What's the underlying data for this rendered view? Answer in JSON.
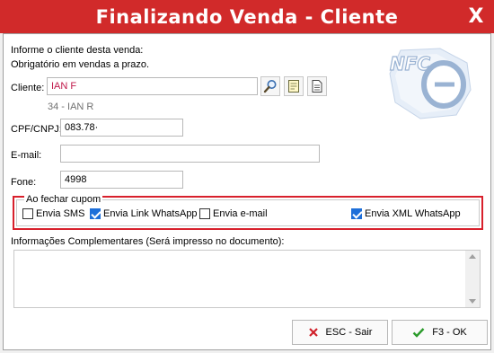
{
  "window": {
    "title": "Finalizando Venda - Cliente",
    "close_label": "X"
  },
  "info": {
    "line1": "Informe o cliente desta venda:",
    "line2": "Obrigatório em vendas a prazo."
  },
  "logo": {
    "text": "NFC"
  },
  "cliente": {
    "label": "Cliente:",
    "value": "IAN F",
    "sub": "34 - IAN R"
  },
  "cpf": {
    "label": "CPF/CNPJ:",
    "value": "083.78·"
  },
  "email": {
    "label": "E-mail:",
    "value": ""
  },
  "fone": {
    "label": "Fone:",
    "value": "4998"
  },
  "cupom": {
    "legend": "Ao fechar cupom",
    "options": [
      {
        "label": "Envia SMS",
        "checked": false
      },
      {
        "label": "Envia Link WhatsApp",
        "checked": true
      },
      {
        "label": "Envia e-mail",
        "checked": false
      },
      {
        "label": "Envia XML WhatsApp",
        "checked": true
      }
    ]
  },
  "complementares": {
    "label": "Informações Complementares (Será impresso no documento):"
  },
  "buttons": {
    "esc": "ESC - Sair",
    "ok": "F3 - OK"
  },
  "colors": {
    "title_bar": "#d12a2a",
    "highlight": "#d8202c",
    "check": "#1e6fd9"
  }
}
